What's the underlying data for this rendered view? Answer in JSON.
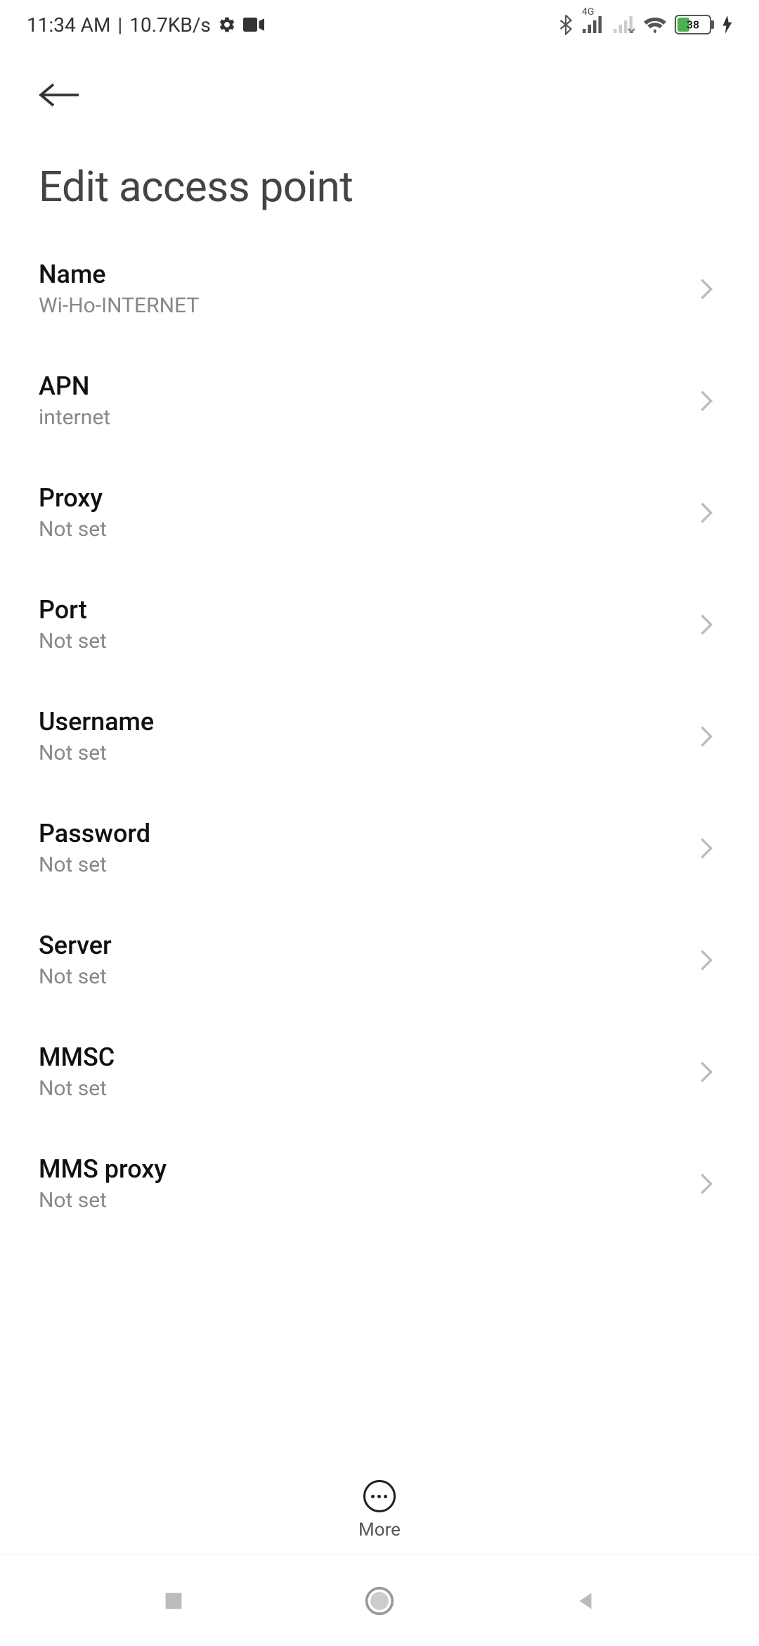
{
  "status": {
    "time": "11:34 AM",
    "separator": "|",
    "speed": "10.7KB/s",
    "network_label": "4G",
    "battery_pct": "38"
  },
  "header": {
    "title": "Edit access point"
  },
  "items": [
    {
      "label": "Name",
      "value": "Wi-Ho-INTERNET"
    },
    {
      "label": "APN",
      "value": "internet"
    },
    {
      "label": "Proxy",
      "value": "Not set"
    },
    {
      "label": "Port",
      "value": "Not set"
    },
    {
      "label": "Username",
      "value": "Not set"
    },
    {
      "label": "Password",
      "value": "Not set"
    },
    {
      "label": "Server",
      "value": "Not set"
    },
    {
      "label": "MMSC",
      "value": "Not set"
    },
    {
      "label": "MMS proxy",
      "value": "Not set"
    }
  ],
  "bottom": {
    "more_label": "More"
  }
}
